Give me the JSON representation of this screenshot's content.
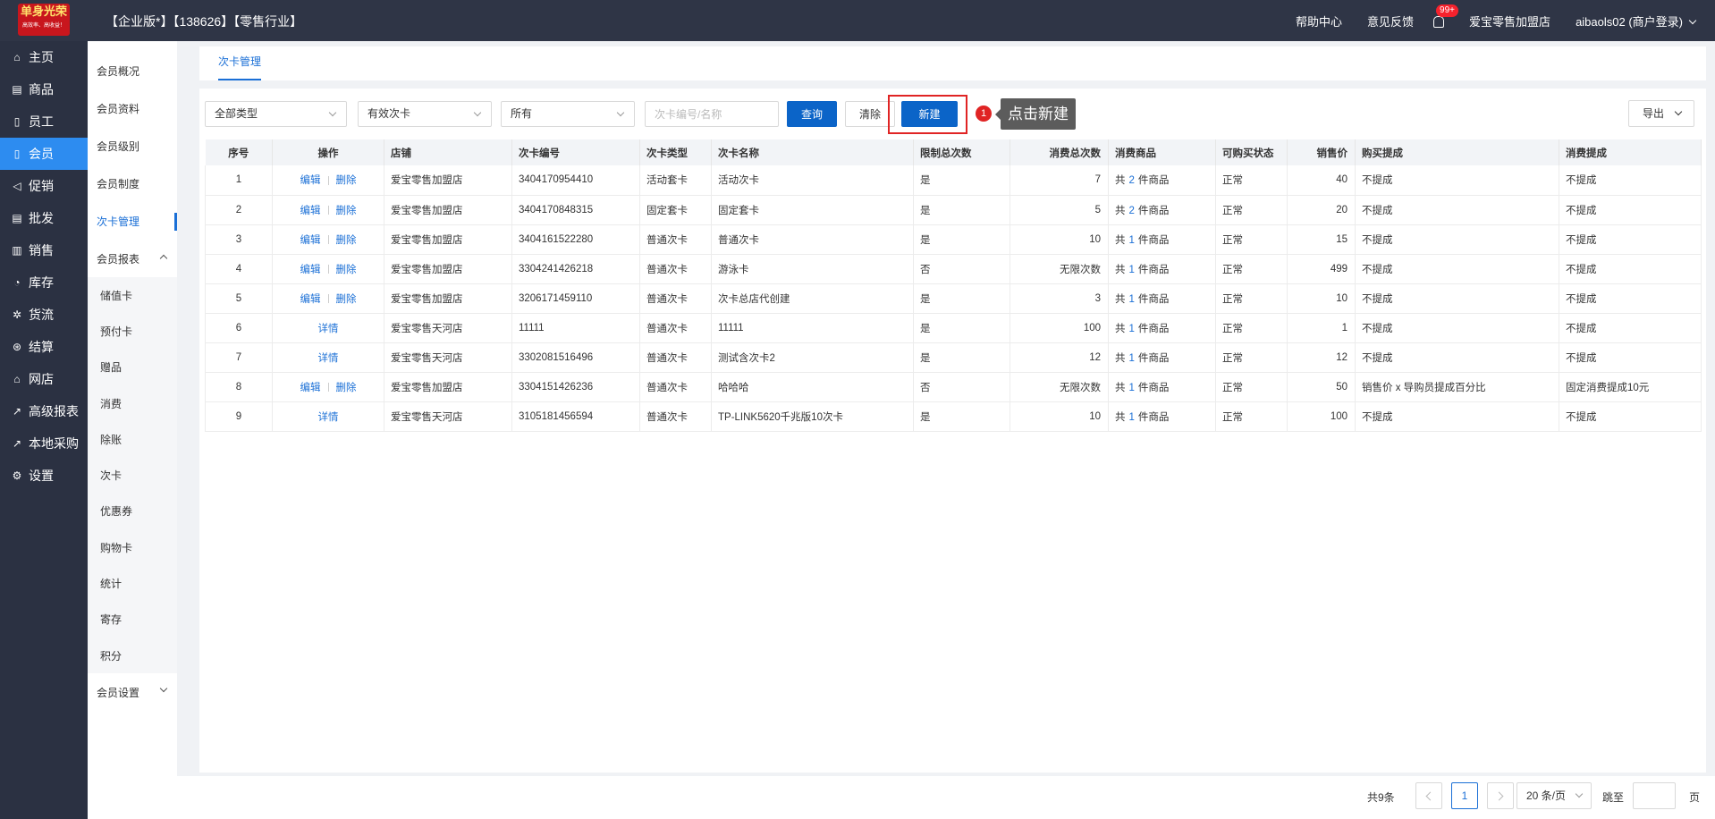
{
  "header": {
    "logo_main": "单身光荣",
    "logo_sub": "高效率、高收益！",
    "title": "【企业版*】【138626】【零售行业】",
    "help": "帮助中心",
    "feedback": "意见反馈",
    "bell_badge": "99+",
    "store": "爱宝零售加盟店",
    "user": "aibaols02 (商户登录)"
  },
  "sidebar": {
    "items": [
      {
        "label": "主页",
        "icon": "⌂"
      },
      {
        "label": "商品",
        "icon": "▤"
      },
      {
        "label": "员工",
        "icon": "▯"
      },
      {
        "label": "会员",
        "icon": "▯"
      },
      {
        "label": "促销",
        "icon": "◁"
      },
      {
        "label": "批发",
        "icon": "▤"
      },
      {
        "label": "销售",
        "icon": "▥"
      },
      {
        "label": "库存",
        "icon": "◔"
      },
      {
        "label": "货流",
        "icon": "✲"
      },
      {
        "label": "结算",
        "icon": "⊛"
      },
      {
        "label": "网店",
        "icon": "⌂"
      },
      {
        "label": "高级报表",
        "icon": "↗"
      },
      {
        "label": "本地采购",
        "icon": "↗"
      },
      {
        "label": "设置",
        "icon": "⚙"
      }
    ]
  },
  "subnav": {
    "items": [
      "会员概况",
      "会员资料",
      "会员级别",
      "会员制度",
      "次卡管理"
    ],
    "report_group": "会员报表",
    "report_items": [
      "储值卡",
      "预付卡",
      "赠品",
      "消费",
      "除账",
      "次卡",
      "优惠券",
      "购物卡",
      "统计",
      "寄存",
      "积分"
    ],
    "settings_group": "会员设置"
  },
  "tab": {
    "label": "次卡管理"
  },
  "filters": {
    "type": "全部类型",
    "validity": "有效次卡",
    "store": "所有",
    "search_placeholder": "次卡编号/名称",
    "search_value": "",
    "query": "查询",
    "clear": "清除",
    "new": "新建",
    "export": "导出"
  },
  "annotation": {
    "step": "1",
    "text": "点击新建"
  },
  "table": {
    "headers": [
      "序号",
      "操作",
      "店铺",
      "次卡编号",
      "次卡类型",
      "次卡名称",
      "限制总次数",
      "消费总次数",
      "消费商品",
      "可购买状态",
      "销售价",
      "购买提成",
      "消费提成"
    ],
    "edit_label": "编辑",
    "delete_label": "删除",
    "detail_label": "详情",
    "goods_prefix": "共",
    "goods_suffix": "件商品",
    "rows": [
      {
        "no": "1",
        "ops": "edit",
        "store": "爱宝零售加盟店",
        "code": "3404170954410",
        "type": "活动套卡",
        "name": "活动次卡",
        "limit": "是",
        "total": "7",
        "goods": "2",
        "status": "正常",
        "price": "40",
        "buy_comm": "不提成",
        "use_comm": "不提成"
      },
      {
        "no": "2",
        "ops": "edit",
        "store": "爱宝零售加盟店",
        "code": "3404170848315",
        "type": "固定套卡",
        "name": "固定套卡",
        "limit": "是",
        "total": "5",
        "goods": "2",
        "status": "正常",
        "price": "20",
        "buy_comm": "不提成",
        "use_comm": "不提成"
      },
      {
        "no": "3",
        "ops": "edit",
        "store": "爱宝零售加盟店",
        "code": "3404161522280",
        "type": "普通次卡",
        "name": "普通次卡",
        "limit": "是",
        "total": "10",
        "goods": "1",
        "status": "正常",
        "price": "15",
        "buy_comm": "不提成",
        "use_comm": "不提成"
      },
      {
        "no": "4",
        "ops": "edit",
        "store": "爱宝零售加盟店",
        "code": "3304241426218",
        "type": "普通次卡",
        "name": "游泳卡",
        "limit": "否",
        "total": "无限次数",
        "goods": "1",
        "status": "正常",
        "price": "499",
        "buy_comm": "不提成",
        "use_comm": "不提成"
      },
      {
        "no": "5",
        "ops": "edit",
        "store": "爱宝零售加盟店",
        "code": "3206171459110",
        "type": "普通次卡",
        "name": "次卡总店代创建",
        "limit": "是",
        "total": "3",
        "goods": "1",
        "status": "正常",
        "price": "10",
        "buy_comm": "不提成",
        "use_comm": "不提成"
      },
      {
        "no": "6",
        "ops": "detail",
        "store": "爱宝零售天河店",
        "code": "11111",
        "type": "普通次卡",
        "name": "11111",
        "limit": "是",
        "total": "100",
        "goods": "1",
        "status": "正常",
        "price": "1",
        "buy_comm": "不提成",
        "use_comm": "不提成"
      },
      {
        "no": "7",
        "ops": "detail",
        "store": "爱宝零售天河店",
        "code": "3302081516496",
        "type": "普通次卡",
        "name": "测试含次卡2",
        "limit": "是",
        "total": "12",
        "goods": "1",
        "status": "正常",
        "price": "12",
        "buy_comm": "不提成",
        "use_comm": "不提成"
      },
      {
        "no": "8",
        "ops": "edit",
        "store": "爱宝零售加盟店",
        "code": "3304151426236",
        "type": "普通次卡",
        "name": "哈哈哈",
        "limit": "否",
        "total": "无限次数",
        "goods": "1",
        "status": "正常",
        "price": "50",
        "buy_comm": "销售价 x 导购员提成百分比",
        "use_comm": "固定消费提成10元"
      },
      {
        "no": "9",
        "ops": "detail",
        "store": "爱宝零售天河店",
        "code": "3105181456594",
        "type": "普通次卡",
        "name": "TP-LINK5620千兆版10次卡",
        "limit": "是",
        "total": "10",
        "goods": "1",
        "status": "正常",
        "price": "100",
        "buy_comm": "不提成",
        "use_comm": "不提成"
      }
    ]
  },
  "pagination": {
    "total": "共9条",
    "current": "1",
    "page_size": "20 条/页",
    "jump_label": "跳至",
    "page_unit": "页"
  },
  "colors": {
    "accent": "#1a6fd6",
    "topbar": "#2f3546",
    "sidebar": "#2b3142",
    "highlight": "#e02424"
  }
}
